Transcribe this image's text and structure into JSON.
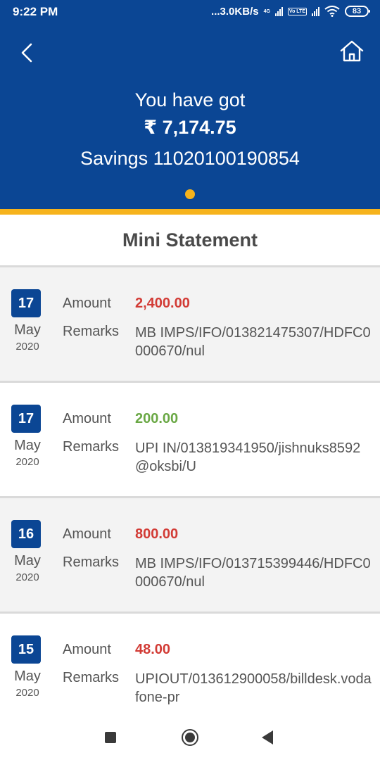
{
  "status_bar": {
    "time": "9:22 PM",
    "data_speed": "...3.0KB/s",
    "network_4g": "4G",
    "volte": "Vo LTE",
    "battery": "83"
  },
  "header": {
    "greeting": "You have got",
    "balance": "₹ 7,174.75",
    "account": "Savings 11020100190854"
  },
  "section_title": "Mini Statement",
  "transactions": [
    {
      "day": "17",
      "month": "May",
      "year": "2020",
      "amount_label": "Amount",
      "amount": "2,400.00",
      "type": "debit",
      "remarks_label": "Remarks",
      "remarks": "MB IMPS/IFO/013821475307/HDFC0000670/nul"
    },
    {
      "day": "17",
      "month": "May",
      "year": "2020",
      "amount_label": "Amount",
      "amount": "200.00",
      "type": "credit",
      "remarks_label": "Remarks",
      "remarks": "UPI IN/013819341950/jishnuks8592@oksbi/U"
    },
    {
      "day": "16",
      "month": "May",
      "year": "2020",
      "amount_label": "Amount",
      "amount": "800.00",
      "type": "debit",
      "remarks_label": "Remarks",
      "remarks": "MB IMPS/IFO/013715399446/HDFC0000670/nul"
    },
    {
      "day": "15",
      "month": "May",
      "year": "2020",
      "amount_label": "Amount",
      "amount": "48.00",
      "type": "debit",
      "remarks_label": "Remarks",
      "remarks": "UPIOUT/013612900058/billdesk.vodafone-pr"
    }
  ],
  "colors": {
    "header_blue": "#0b4694",
    "accent_yellow": "#f6b31c",
    "debit_red": "#d23b35",
    "credit_green": "#6aa845"
  },
  "icons": {
    "back": "chevron-left-icon",
    "home": "home-icon",
    "nav_recents": "square-icon",
    "nav_home": "circle-icon",
    "nav_back": "triangle-left-icon"
  }
}
